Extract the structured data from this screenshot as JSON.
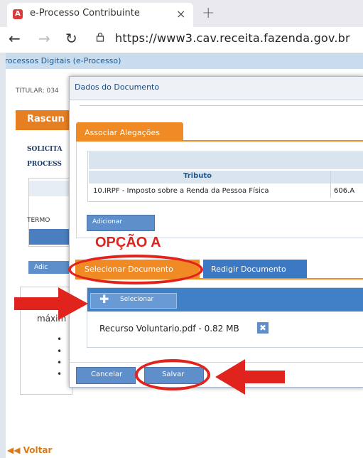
{
  "browser": {
    "tab_title": "e-Processo Contribuinte",
    "tab_close": "×",
    "new_tab": "+",
    "url": "https://www3.cav.receita.fazenda.gov.br"
  },
  "page": {
    "header": "Processos Digitais (e-Processo)",
    "titular": "TITULAR: 034",
    "rascunho": "Rascun",
    "solicita": "SOLICITA",
    "process": "PROCESS",
    "termo": "TERMO",
    "adic_button": "Adic",
    "maxim": "máxim",
    "bullets": [
      "•",
      "•",
      "•",
      "•"
    ],
    "voltar": "◀◀ Voltar"
  },
  "dialog": {
    "title": "Dados do Documento",
    "tab_alegacoes": "Associar Alegações",
    "table": {
      "header_tributo": "Tributo",
      "row_tributo": "10.IRPF - Imposto sobre a Renda da Pessoa Física",
      "row_valor": "606.A"
    },
    "adicionar": "Adicionar",
    "tab_selecionar": "Selecionar Documento",
    "tab_redigir": "Redigir Documento",
    "selecionar": "Selecionar",
    "file": "Recurso Voluntario.pdf - 0.82 MB",
    "remove": "✖",
    "cancelar": "Cancelar",
    "salvar": "Salvar"
  },
  "annotation": {
    "opcao": "OPÇÃO A",
    "color": "#e0231c"
  }
}
